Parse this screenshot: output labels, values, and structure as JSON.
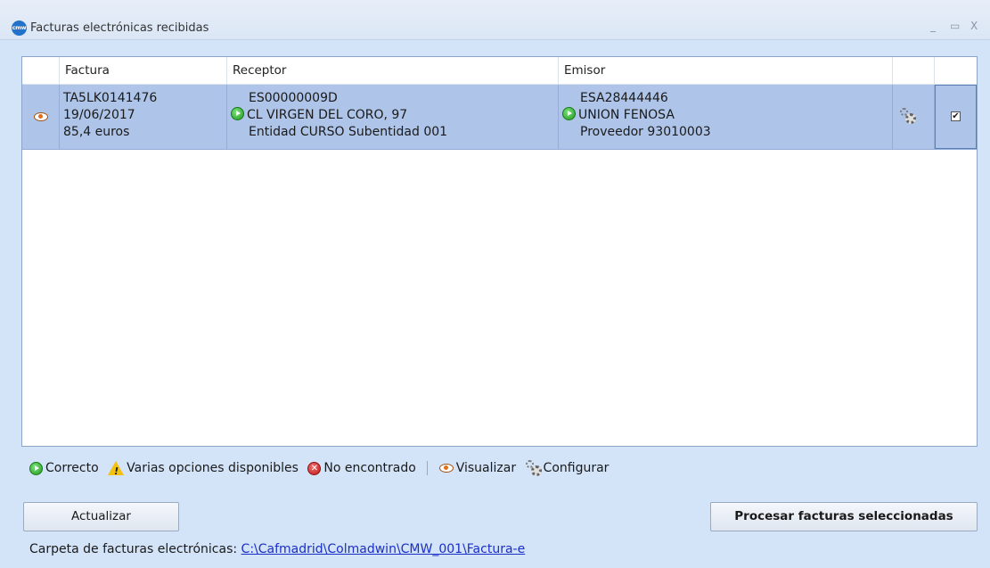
{
  "window": {
    "title": "Facturas electrónicas recibidas",
    "logo_text": "cmw",
    "minimize_glyph": "_",
    "maximize_glyph": "▭",
    "close_glyph": "X"
  },
  "grid": {
    "columns": [
      {
        "key": "eye",
        "label": ""
      },
      {
        "key": "factura",
        "label": "Factura"
      },
      {
        "key": "receptor",
        "label": "Receptor"
      },
      {
        "key": "emisor",
        "label": "Emisor"
      },
      {
        "key": "config",
        "label": ""
      },
      {
        "key": "check",
        "label": ""
      }
    ],
    "rows": [
      {
        "factura": {
          "number": "TA5LK0141476",
          "date": "19/06/2017",
          "amount": "85,4 euros"
        },
        "receptor": {
          "nif": "ES00000009D",
          "address": "CL VIRGEN DEL CORO, 97",
          "entity": "Entidad CURSO Subentidad 001",
          "status": "correcto"
        },
        "emisor": {
          "nif": "ESA28444446",
          "name": "UNION FENOSA",
          "supplier": "Proveedor 93010003",
          "status": "correcto"
        },
        "checked": true,
        "check_glyph": "✔"
      }
    ]
  },
  "legend": {
    "correcto": "Correcto",
    "varias": "Varias opciones disponibles",
    "no_encontrado": "No encontrado",
    "visualizar": "Visualizar",
    "configurar": "Configurar",
    "error_glyph": "✕"
  },
  "buttons": {
    "actualizar": "Actualizar",
    "procesar": "Procesar facturas seleccionadas"
  },
  "footer": {
    "label": "Carpeta de facturas electrónicas:",
    "path": "C:\\Cafmadrid\\Colmadwin\\CMW_001\\Factura-e"
  },
  "colors": {
    "accent": "#2272c9",
    "selected_row": "#aec4e8",
    "window_bg": "#d3e3f8",
    "link": "#1a2ec8"
  },
  "icons": {
    "eye": "eye-icon",
    "gear": "gear-icon",
    "ok": "ok-circle-icon",
    "warning": "warning-icon",
    "error": "error-icon"
  }
}
